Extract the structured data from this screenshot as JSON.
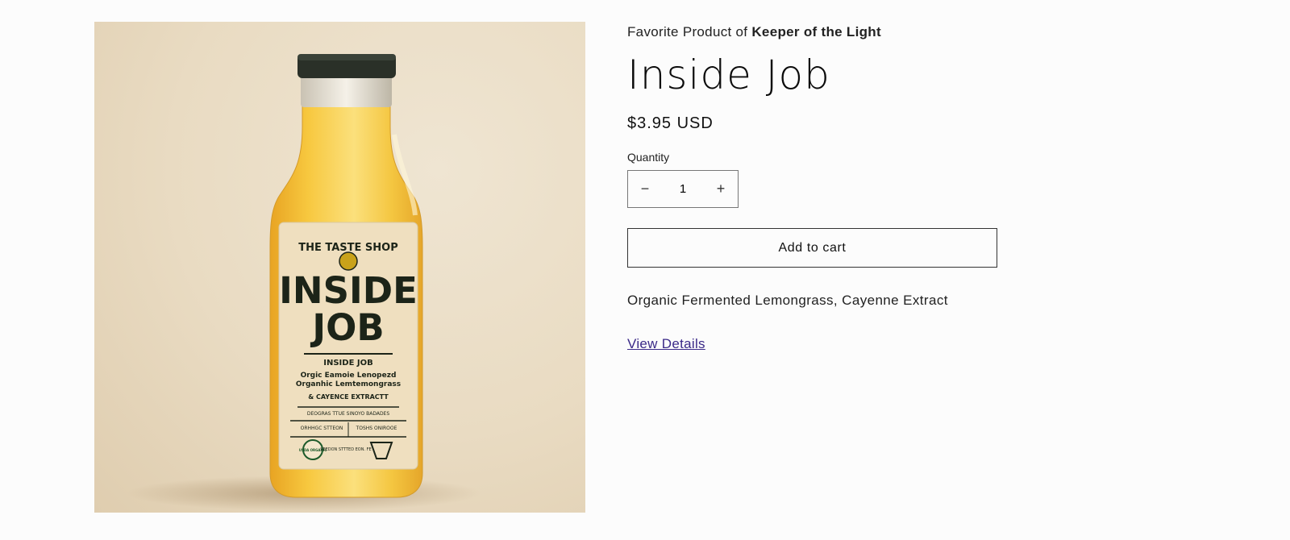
{
  "product": {
    "vendor_prefix": "Favorite Product of",
    "vendor_name": "Keeper of the Light",
    "title": "Inside Job",
    "price": "$3.95 USD",
    "quantity_label": "Quantity",
    "quantity_value": "1",
    "decrease_symbol": "−",
    "increase_symbol": "+",
    "add_to_cart_label": "Add to cart",
    "description": "Organic Fermented Lemongrass, Cayenne Extract",
    "details_link": "View Details"
  },
  "label": {
    "brand": "THE TASTE SHOP",
    "name_line1": "INSIDE",
    "name_line2": "JOB",
    "subtitle": "INSIDE JOB",
    "line1": "Orgic Eamoie Lenopezd",
    "line2": "Organhic Lemtemongrass",
    "line3": "& CAYENCE EXTRACTT",
    "small1": "DEOGRAS TTUE SINOYO BADADES",
    "small2a": "ORHHGC STTEON",
    "small2b": "TOSHS ONIROOE",
    "badge": "USDA ORGANIC",
    "small3": "SEEDON STTTED EON. FE"
  },
  "colors": {
    "link": "#3b2a88",
    "juice": "#f2c13a",
    "cap": "#2a3028",
    "label_bg": "#efdfbf",
    "label_text": "#1c2418"
  }
}
